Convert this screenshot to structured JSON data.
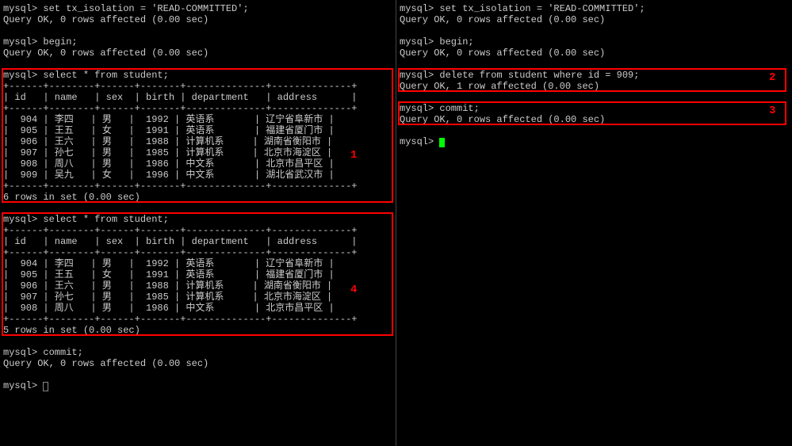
{
  "left": {
    "set_iso": "mysql> set tx_isolation = 'READ-COMMITTED';",
    "set_iso_ok": "Query OK, 0 rows affected (0.00 sec)",
    "begin": "mysql> begin;",
    "begin_ok": "Query OK, 0 rows affected (0.00 sec)",
    "select1": "mysql> select * from student;",
    "hdr_sep": "+------+--------+------+-------+--------------+--------------+",
    "hdr": "| id   | name   | sex  | birth | department   | address      |",
    "rows1": [
      "|  904 | 李四   | 男   |  1992 | 英语系       | 辽宁省阜新市 |",
      "|  905 | 王五   | 女   |  1991 | 英语系       | 福建省厦门市 |",
      "|  906 | 王六   | 男   |  1988 | 计算机系     | 湖南省衡阳市 |",
      "|  907 | 孙七   | 男   |  1985 | 计算机系     | 北京市海淀区 |",
      "|  908 | 周八   | 男   |  1986 | 中文系       | 北京市昌平区 |",
      "|  909 | 吴九   | 女   |  1996 | 中文系       | 湖北省武汉市 |"
    ],
    "set1_count": "6 rows in set (0.00 sec)",
    "select2": "mysql> select * from student;",
    "rows2": [
      "|  904 | 李四   | 男   |  1992 | 英语系       | 辽宁省阜新市 |",
      "|  905 | 王五   | 女   |  1991 | 英语系       | 福建省厦门市 |",
      "|  906 | 王六   | 男   |  1988 | 计算机系     | 湖南省衡阳市 |",
      "|  907 | 孙七   | 男   |  1985 | 计算机系     | 北京市海淀区 |",
      "|  908 | 周八   | 男   |  1986 | 中文系       | 北京市昌平区 |"
    ],
    "set2_count": "5 rows in set (0.00 sec)",
    "commit": "mysql> commit;",
    "commit_ok": "Query OK, 0 rows affected (0.00 sec)",
    "prompt": "mysql> "
  },
  "right": {
    "set_iso": "mysql> set tx_isolation = 'READ-COMMITTED';",
    "set_iso_ok": "Query OK, 0 rows affected (0.00 sec)",
    "begin": "mysql> begin;",
    "begin_ok": "Query OK, 0 rows affected (0.00 sec)",
    "delete": "mysql> delete from student where id = 909;",
    "delete_ok": "Query OK, 1 row affected (0.00 sec)",
    "commit": "mysql> commit;",
    "commit_ok": "Query OK, 0 rows affected (0.00 sec)",
    "prompt": "mysql> "
  },
  "labels": {
    "l1": "1",
    "l2": "2",
    "l3": "3",
    "l4": "4"
  },
  "chart_data": {
    "type": "table",
    "title": "student",
    "columns": [
      "id",
      "name",
      "sex",
      "birth",
      "department",
      "address"
    ],
    "result_set_1": {
      "rows": [
        {
          "id": 904,
          "name": "李四",
          "sex": "男",
          "birth": 1992,
          "department": "英语系",
          "address": "辽宁省阜新市"
        },
        {
          "id": 905,
          "name": "王五",
          "sex": "女",
          "birth": 1991,
          "department": "英语系",
          "address": "福建省厦门市"
        },
        {
          "id": 906,
          "name": "王六",
          "sex": "男",
          "birth": 1988,
          "department": "计算机系",
          "address": "湖南省衡阳市"
        },
        {
          "id": 907,
          "name": "孙七",
          "sex": "男",
          "birth": 1985,
          "department": "计算机系",
          "address": "北京市海淀区"
        },
        {
          "id": 908,
          "name": "周八",
          "sex": "男",
          "birth": 1986,
          "department": "中文系",
          "address": "北京市昌平区"
        },
        {
          "id": 909,
          "name": "吴九",
          "sex": "女",
          "birth": 1996,
          "department": "中文系",
          "address": "湖北省武汉市"
        }
      ],
      "row_count": 6
    },
    "result_set_2": {
      "rows": [
        {
          "id": 904,
          "name": "李四",
          "sex": "男",
          "birth": 1992,
          "department": "英语系",
          "address": "辽宁省阜新市"
        },
        {
          "id": 905,
          "name": "王五",
          "sex": "女",
          "birth": 1991,
          "department": "英语系",
          "address": "福建省厦门市"
        },
        {
          "id": 906,
          "name": "王六",
          "sex": "男",
          "birth": 1988,
          "department": "计算机系",
          "address": "湖南省衡阳市"
        },
        {
          "id": 907,
          "name": "孙七",
          "sex": "男",
          "birth": 1985,
          "department": "计算机系",
          "address": "北京市海淀区"
        },
        {
          "id": 908,
          "name": "周八",
          "sex": "男",
          "birth": 1986,
          "department": "中文系",
          "address": "北京市昌平区"
        }
      ],
      "row_count": 5
    }
  }
}
